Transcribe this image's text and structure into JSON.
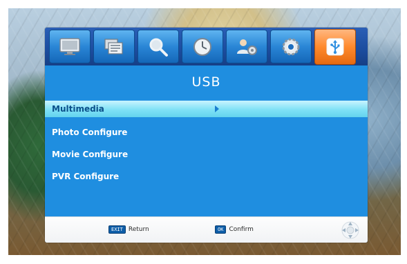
{
  "tabs": [
    {
      "name": "picture",
      "icon": "monitor-icon",
      "active": false
    },
    {
      "name": "channel",
      "icon": "channel-list-icon",
      "active": false
    },
    {
      "name": "search",
      "icon": "magnifier-icon",
      "active": false
    },
    {
      "name": "time",
      "icon": "clock-icon",
      "active": false
    },
    {
      "name": "option",
      "icon": "user-gear-icon",
      "active": false
    },
    {
      "name": "system",
      "icon": "gear-icon",
      "active": false
    },
    {
      "name": "usb",
      "icon": "usb-icon",
      "active": true
    }
  ],
  "menu": {
    "title": "USB",
    "items": [
      {
        "label": "Multimedia",
        "selected": true
      },
      {
        "label": "Photo Configure",
        "selected": false
      },
      {
        "label": "Movie Configure",
        "selected": false
      },
      {
        "label": "PVR Configure",
        "selected": false
      }
    ]
  },
  "footer": {
    "return_key": "EXIT",
    "return_label": "Return",
    "confirm_key": "OK",
    "confirm_label": "Confirm"
  },
  "colors": {
    "panel": "#1f8ee0",
    "highlight": "#7fe1f6",
    "active_tab": "#ff8a2d"
  }
}
